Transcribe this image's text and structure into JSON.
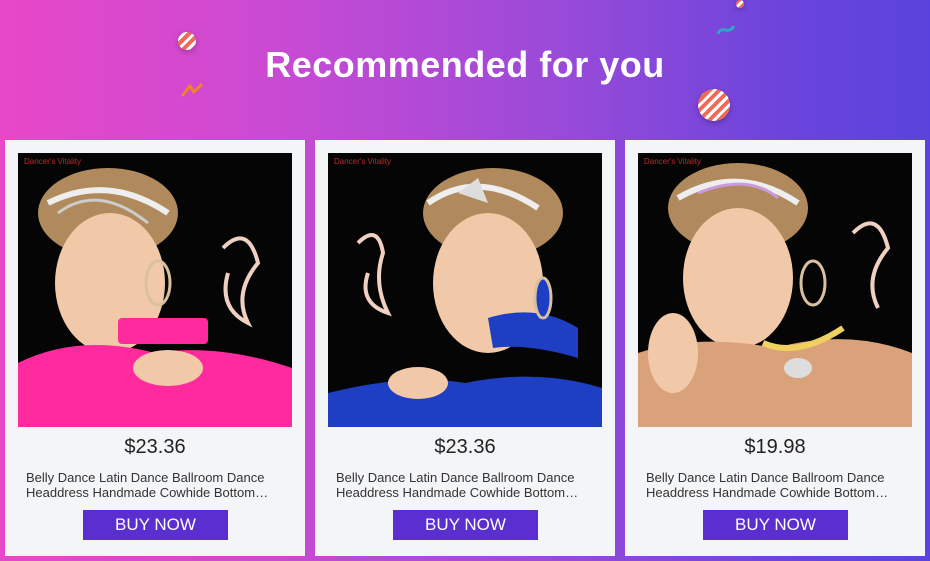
{
  "banner": {
    "title": "Recommended for you"
  },
  "products": [
    {
      "brand": "Dancer's Vitality",
      "price": "$23.36",
      "desc_line1": "Belly Dance Latin Dance Ballroom Dance",
      "desc_line2": "Headdress Handmade Cowhide Bottom…",
      "button": "BUY NOW",
      "accent": "#ff2a9e"
    },
    {
      "brand": "Dancer's Vitality",
      "price": "$23.36",
      "desc_line1": "Belly Dance Latin Dance Ballroom Dance",
      "desc_line2": "Headdress Handmade Cowhide Bottom…",
      "button": "BUY NOW",
      "accent": "#1e3fc4"
    },
    {
      "brand": "Dancer's Vitality",
      "price": "$19.98",
      "desc_line1": "Belly Dance Latin Dance Ballroom Dance",
      "desc_line2": "Headdress Handmade Cowhide Bottom…",
      "button": "BUY NOW",
      "accent": "#d9a27a"
    }
  ],
  "colors": {
    "button_bg": "#5b2ed0",
    "card_bg": "#f4f5f7"
  }
}
